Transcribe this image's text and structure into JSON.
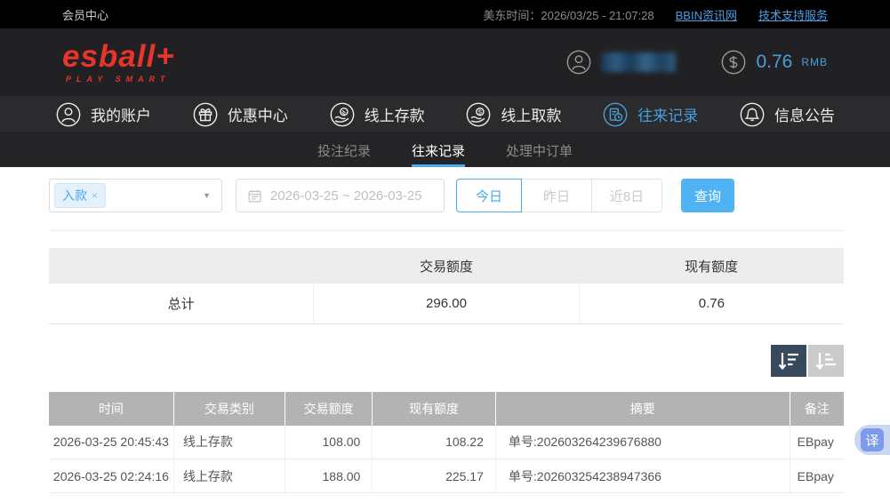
{
  "topbar": {
    "member_center": "会员中心",
    "time_label": "美东时间：2026/03/25 - 21:07:28",
    "links": [
      {
        "label": "BBIN资讯网"
      },
      {
        "label": "技术支持服务"
      }
    ]
  },
  "header": {
    "logo_text": "esball+",
    "logo_tagline": "PLAY SMART",
    "balance_amount": "0.76",
    "balance_currency": "RMB"
  },
  "nav": {
    "items": [
      {
        "label": "我的账户",
        "icon": "user-icon",
        "active": false
      },
      {
        "label": "优惠中心",
        "icon": "gift-icon",
        "active": false
      },
      {
        "label": "线上存款",
        "icon": "deposit-icon",
        "active": false
      },
      {
        "label": "线上取款",
        "icon": "withdraw-icon",
        "active": false
      },
      {
        "label": "往来记录",
        "icon": "records-icon",
        "active": true
      },
      {
        "label": "信息公告",
        "icon": "bell-icon",
        "active": false
      }
    ]
  },
  "subnav": {
    "tabs": [
      {
        "label": "投注纪录",
        "active": false
      },
      {
        "label": "往来记录",
        "active": true
      },
      {
        "label": "处理中订单",
        "active": false
      }
    ]
  },
  "filters": {
    "type_tag": "入款",
    "type_tag_close": "×",
    "date_range": "2026-03-25 ~ 2026-03-25",
    "quick_buttons": [
      {
        "label": "今日",
        "active": true
      },
      {
        "label": "昨日",
        "active": false
      },
      {
        "label": "近8日",
        "active": false
      }
    ],
    "search_label": "查询"
  },
  "summary_table": {
    "headers": {
      "col1": "",
      "col2": "交易额度",
      "col3": "现有额度"
    },
    "row": {
      "label": "总计",
      "transaction_amount": "296.00",
      "current_balance": "0.76"
    }
  },
  "records_table": {
    "headers": {
      "time": "时间",
      "type": "交易类别",
      "amount": "交易额度",
      "balance": "现有额度",
      "summary": "摘要",
      "remark": "备注"
    },
    "rows": [
      {
        "time": "2026-03-25 20:45:43",
        "type": "线上存款",
        "amount": "108.00",
        "balance": "108.22",
        "summary": "单号:202603264239676880",
        "remark": "EBpay"
      },
      {
        "time": "2026-03-25 02:24:16",
        "type": "线上存款",
        "amount": "188.00",
        "balance": "225.17",
        "summary": "单号:202603254238947366",
        "remark": "EBpay"
      }
    ]
  },
  "floating": {
    "translate_label": "译"
  },
  "colors": {
    "accent": "#4aa9e9",
    "search_button": "#4fb3f3",
    "logo_red": "#e8342b",
    "sort_active_bg": "#37495c"
  }
}
